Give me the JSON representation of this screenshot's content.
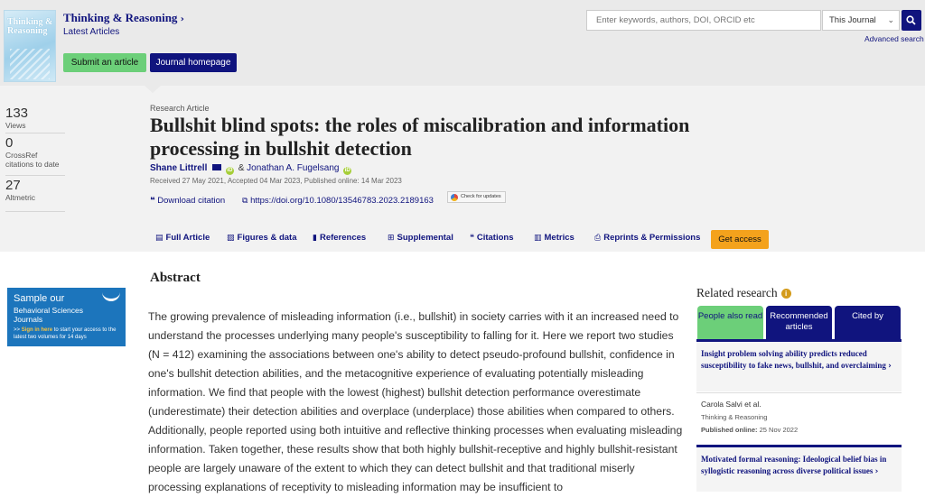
{
  "journal": {
    "cover_title": "Thinking & Reasoning",
    "title": "Thinking & Reasoning",
    "latest_link": "Latest Articles",
    "submit_button": "Submit an article",
    "home_button": "Journal homepage"
  },
  "search": {
    "placeholder": "Enter keywords, authors, DOI, ORCID etc",
    "scope": "This Journal",
    "advanced": "Advanced search"
  },
  "metrics": [
    {
      "value": "133",
      "label": "Views"
    },
    {
      "value": "0",
      "label": "CrossRef citations to date"
    },
    {
      "value": "27",
      "label": "Altmetric"
    }
  ],
  "article": {
    "type": "Research Article",
    "title": "Bullshit blind spots: the roles of miscalibration and information processing in bullshit detection",
    "author1": "Shane Littrell",
    "author_sep": "&",
    "author2": "Jonathan A. Fugelsang",
    "dates": "Received 27 May 2021, Accepted 04 Mar 2023, Published online: 14 Mar 2023",
    "download_citation": "Download citation",
    "doi": "https://doi.org/10.1080/13546783.2023.2189163",
    "check_updates": "Check for updates"
  },
  "tabs": [
    {
      "label": "Full Article"
    },
    {
      "label": "Figures & data"
    },
    {
      "label": "References"
    },
    {
      "label": "Supplemental"
    },
    {
      "label": "Citations"
    },
    {
      "label": "Metrics"
    },
    {
      "label": "Reprints & Permissions"
    }
  ],
  "get_access": "Get access",
  "ad": {
    "line1": "Sample our",
    "line2": "Behavioral Sciences Journals",
    "line3_prefix": ">>",
    "line3_link": "Sign in here",
    "line3_rest": "to start your access to the latest two volumes for 14 days"
  },
  "abstract": {
    "heading": "Abstract",
    "text": "The growing prevalence of misleading information (i.e., bullshit) in society carries with it an increased need to understand the processes underlying many people's susceptibility to falling for it. Here we report two studies (N = 412) examining the associations between one's ability to detect pseudo-profound bullshit, confidence in one's bullshit detection abilities, and the metacognitive experience of evaluating potentially misleading information. We find that people with the lowest (highest) bullshit detection performance overestimate (underestimate) their detection abilities and overplace (underplace) those abilities when compared to others. Additionally, people reported using both intuitive and reflective thinking processes when evaluating misleading information. Taken together, these results show that both highly bullshit-receptive and highly bullshit-resistant people are largely unaware of the extent to which they can detect bullshit and that traditional miserly processing explanations of receptivity to misleading information may be insufficient to"
  },
  "related": {
    "heading": "Related research",
    "tabs": [
      "People also read",
      "Recommended articles",
      "Cited by"
    ],
    "items": [
      {
        "title": "Insight problem solving ability predicts reduced susceptibility to fake news, bullshit, and overclaiming",
        "author": "Carola Salvi et al.",
        "journal": "Thinking & Reasoning",
        "published_label": "Published online:",
        "published_date": "25 Nov 2022"
      },
      {
        "title": "Motivated formal reasoning: Ideological belief bias in syllogistic reasoning across diverse political issues"
      }
    ]
  }
}
